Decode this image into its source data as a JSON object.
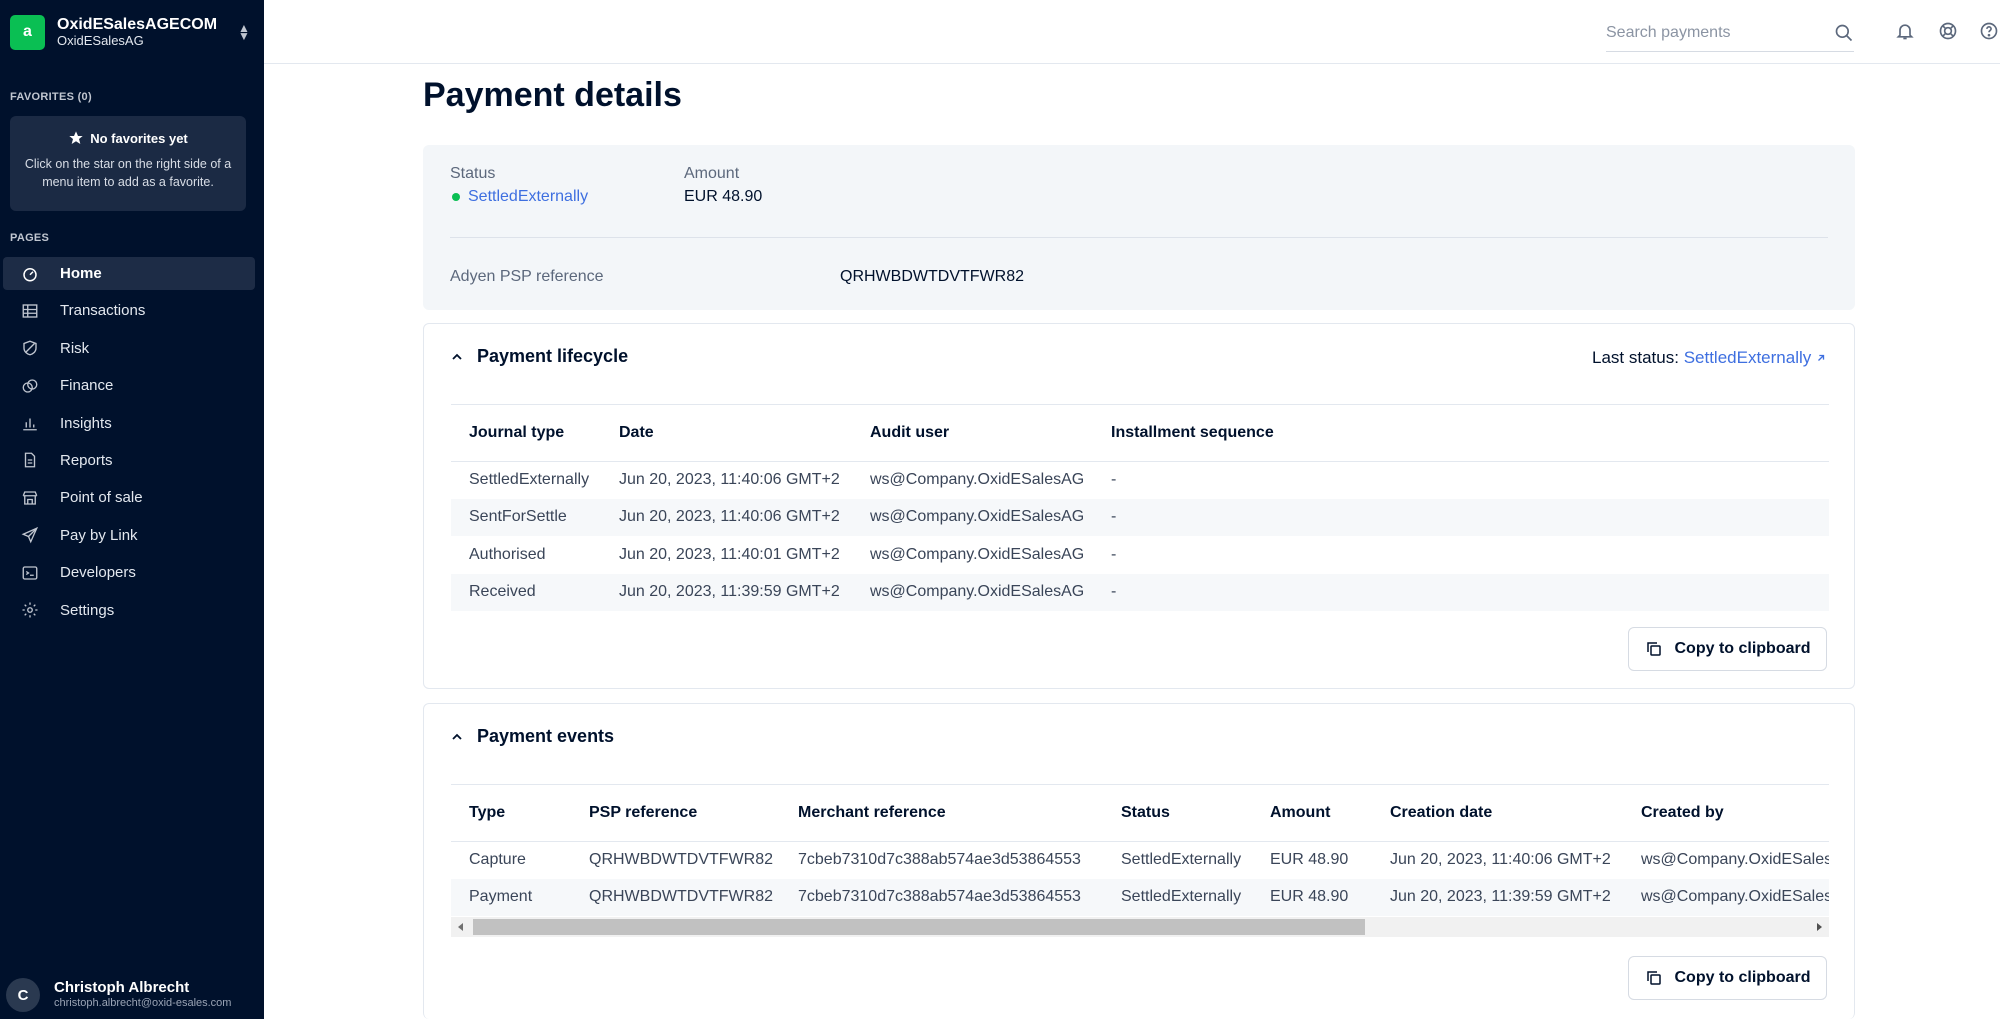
{
  "account": {
    "name": "OxidESalesAGECOM",
    "sub": "OxidESalesAG",
    "logo_letter": "a"
  },
  "favorites": {
    "label": "FAVORITES (0)",
    "title": "No favorites yet",
    "desc": "Click on the star on the right side of a menu item to add as a favorite."
  },
  "pages_label": "PAGES",
  "nav": [
    {
      "label": "Home",
      "icon": "home-icon",
      "active": true
    },
    {
      "label": "Transactions",
      "icon": "table-icon"
    },
    {
      "label": "Risk",
      "icon": "shield-icon"
    },
    {
      "label": "Finance",
      "icon": "coins-icon"
    },
    {
      "label": "Insights",
      "icon": "bar-chart-icon"
    },
    {
      "label": "Reports",
      "icon": "document-icon"
    },
    {
      "label": "Point of sale",
      "icon": "store-icon"
    },
    {
      "label": "Pay by Link",
      "icon": "paper-plane-icon"
    },
    {
      "label": "Developers",
      "icon": "terminal-icon"
    },
    {
      "label": "Settings",
      "icon": "gear-icon"
    }
  ],
  "user": {
    "initial": "C",
    "name": "Christoph Albrecht",
    "email": "christoph.albrecht@oxid-esales.com"
  },
  "search": {
    "placeholder": "Search payments"
  },
  "page_title": "Payment details",
  "summary": {
    "status_label": "Status",
    "status_value": "SettledExternally",
    "amount_label": "Amount",
    "amount_value": "EUR 48.90",
    "psp_label": "Adyen PSP reference",
    "psp_value": "QRHWBDWTDVTFWR82"
  },
  "lifecycle": {
    "title": "Payment lifecycle",
    "last_status_label": "Last status:",
    "last_status_value": "SettledExternally",
    "columns": [
      "Journal type",
      "Date",
      "Audit user",
      "Installment sequence"
    ],
    "rows": [
      [
        "SettledExternally",
        "Jun 20, 2023, 11:40:06 GMT+2",
        "ws@Company.OxidESalesAG",
        "-"
      ],
      [
        "SentForSettle",
        "Jun 20, 2023, 11:40:06 GMT+2",
        "ws@Company.OxidESalesAG",
        "-"
      ],
      [
        "Authorised",
        "Jun 20, 2023, 11:40:01 GMT+2",
        "ws@Company.OxidESalesAG",
        "-"
      ],
      [
        "Received",
        "Jun 20, 2023, 11:39:59 GMT+2",
        "ws@Company.OxidESalesAG",
        "-"
      ]
    ],
    "copy_label": "Copy to clipboard"
  },
  "events": {
    "title": "Payment events",
    "columns": [
      "Type",
      "PSP reference",
      "Merchant reference",
      "Status",
      "Amount",
      "Creation date",
      "Created by"
    ],
    "rows": [
      [
        "Capture",
        "QRHWBDWTDVTFWR82",
        "7cbeb7310d7c388ab574ae3d53864553",
        "SettledExternally",
        "EUR 48.90",
        "Jun 20, 2023, 11:40:06 GMT+2",
        "ws@Company.OxidESales"
      ],
      [
        "Payment",
        "QRHWBDWTDVTFWR82",
        "7cbeb7310d7c388ab574ae3d53864553",
        "SettledExternally",
        "EUR 48.90",
        "Jun 20, 2023, 11:39:59 GMT+2",
        "ws@Company.OxidESales"
      ]
    ],
    "copy_label": "Copy to clipboard"
  }
}
